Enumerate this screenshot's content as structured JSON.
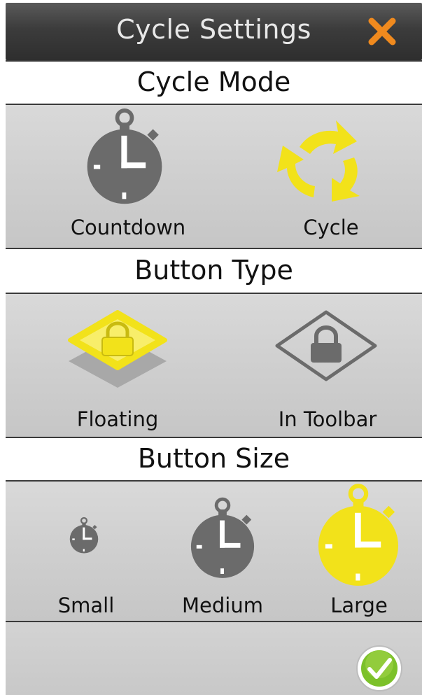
{
  "window": {
    "title": "Cycle Settings",
    "close_icon": "close-x-icon"
  },
  "colors": {
    "selected": "#f2e21a",
    "unselected": "#6b6b6b",
    "close": "#f08a1e",
    "confirm": "#7cc12a"
  },
  "cycle_mode": {
    "header": "Cycle Mode",
    "options": [
      {
        "label": "Countdown",
        "icon": "stopwatch-icon",
        "selected": false
      },
      {
        "label": "Cycle",
        "icon": "cycle-arrows-icon",
        "selected": true
      }
    ]
  },
  "button_type": {
    "header": "Button Type",
    "options": [
      {
        "label": "Floating",
        "icon": "floating-lock-icon",
        "selected": true
      },
      {
        "label": "In Toolbar",
        "icon": "toolbar-lock-icon",
        "selected": false
      }
    ]
  },
  "button_size": {
    "header": "Button Size",
    "options": [
      {
        "label": "Small",
        "icon": "stopwatch-small-icon",
        "selected": false
      },
      {
        "label": "Medium",
        "icon": "stopwatch-medium-icon",
        "selected": false
      },
      {
        "label": "Large",
        "icon": "stopwatch-large-icon",
        "selected": true
      }
    ]
  },
  "footer": {
    "confirm_icon": "checkmark-confirm-icon"
  }
}
